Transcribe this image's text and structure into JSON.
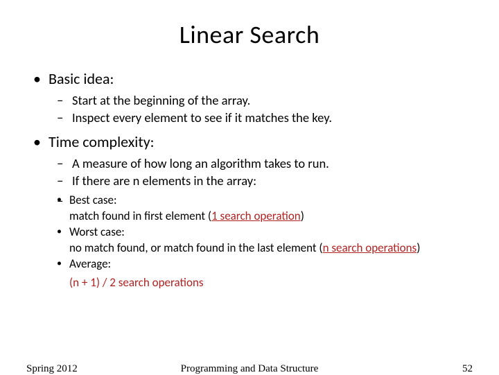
{
  "title": "Linear Search",
  "bullets": {
    "basic_idea": {
      "label": "Basic idea:",
      "sub": [
        "Start at the beginning of the array.",
        "Inspect every element to see if it matches the key."
      ]
    },
    "time_complexity": {
      "label": "Time complexity:",
      "sub": [
        "A measure of how long an algorithm takes to run.",
        "If there are n elements in the array:"
      ],
      "cases": {
        "best_label": "Best case:",
        "best_text_a": "match found in first element (",
        "best_text_b": "1 search operation",
        "best_text_c": ")",
        "worst_label": "Worst case:",
        "worst_text_a": "no match found, or match found in the last element (",
        "worst_text_b": "n search operations",
        "worst_text_c": ")",
        "avg_label": "Average:",
        "avg_value": "(n + 1) / 2  search operations"
      }
    }
  },
  "footer": {
    "semester": "Spring 2012",
    "course": "Programming and Data Structure",
    "page": "52"
  }
}
